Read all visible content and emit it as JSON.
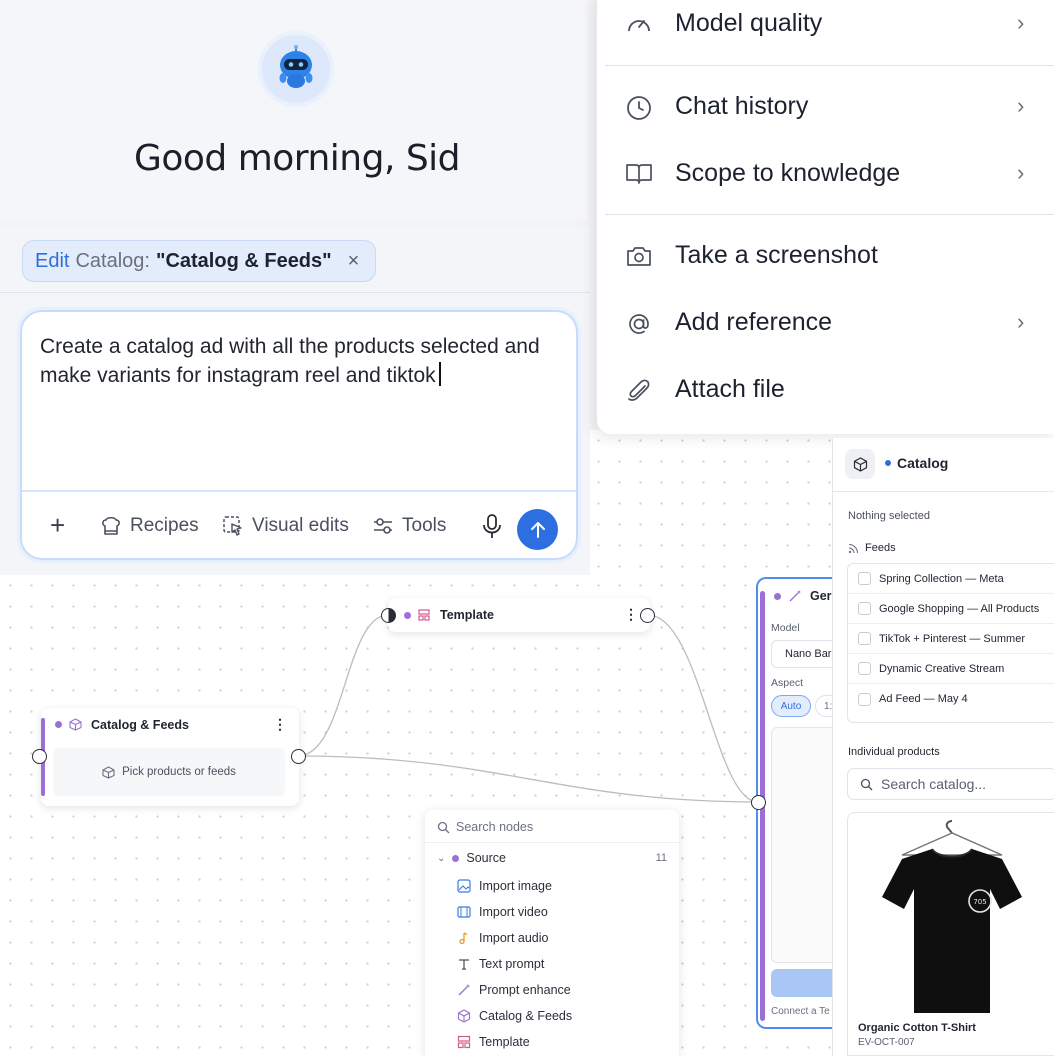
{
  "greeting": {
    "text": "Good morning, Sid"
  },
  "composer": {
    "chip": {
      "edit": "Edit",
      "kind": "Catalog:",
      "name": "\"Catalog & Feeds\"",
      "close": "×"
    },
    "prompt": "Create a catalog ad with all the products selected and make variants for instagram reel and tiktok",
    "toolbar": {
      "add": "+",
      "recipes": "Recipes",
      "visual_edits": "Visual edits",
      "tools": "Tools"
    }
  },
  "menu": {
    "items": [
      {
        "label": "Model quality",
        "icon": "gauge-icon",
        "chevron": "›"
      },
      {
        "label": "Chat history",
        "icon": "clock-icon",
        "chevron": "›"
      },
      {
        "label": "Scope to knowledge",
        "icon": "book-icon",
        "chevron": "›"
      },
      {
        "label": "Take a screenshot",
        "icon": "camera-icon",
        "chevron": ""
      },
      {
        "label": "Add reference",
        "icon": "at-icon",
        "chevron": "›"
      },
      {
        "label": "Attach file",
        "icon": "paperclip-icon",
        "chevron": ""
      }
    ]
  },
  "nodes": {
    "template": {
      "title": "Template",
      "menu": "⋮"
    },
    "catalog": {
      "title": "Catalog & Feeds",
      "menu": "⋮",
      "placeholder": "Pick products or feeds"
    },
    "generate": {
      "title": "Ger",
      "model_label": "Model",
      "model_value": "Nano Bar",
      "aspect_label": "Aspect",
      "aspect_auto": "Auto",
      "aspect_other": "1:",
      "footer": "Connect a Te"
    }
  },
  "search_nodes": {
    "placeholder": "Search nodes",
    "group": {
      "label": "Source",
      "count": "11"
    },
    "items": [
      {
        "label": "Import image",
        "icon": "image-icon"
      },
      {
        "label": "Import video",
        "icon": "film-icon"
      },
      {
        "label": "Import audio",
        "icon": "music-note-icon"
      },
      {
        "label": "Text prompt",
        "icon": "text-icon"
      },
      {
        "label": "Prompt enhance",
        "icon": "magic-wand-icon"
      },
      {
        "label": "Catalog & Feeds",
        "icon": "cube-icon"
      },
      {
        "label": "Template",
        "icon": "template-icon"
      }
    ]
  },
  "catalog_panel": {
    "title": "Catalog",
    "selection": "Nothing selected",
    "feeds_label": "Feeds",
    "feeds": [
      "Spring Collection — Meta",
      "Google Shopping — All Products",
      "TikTok + Pinterest — Summer",
      "Dynamic Creative Stream",
      "Ad Feed — May 4"
    ],
    "individual_label": "Individual products",
    "search_placeholder": "Search catalog...",
    "product": {
      "name": "Organic Cotton T-Shirt",
      "sku": "EV-OCT-007"
    }
  },
  "colors": {
    "accent": "#2d6fe0",
    "node_purple": "#9b6fd6"
  }
}
